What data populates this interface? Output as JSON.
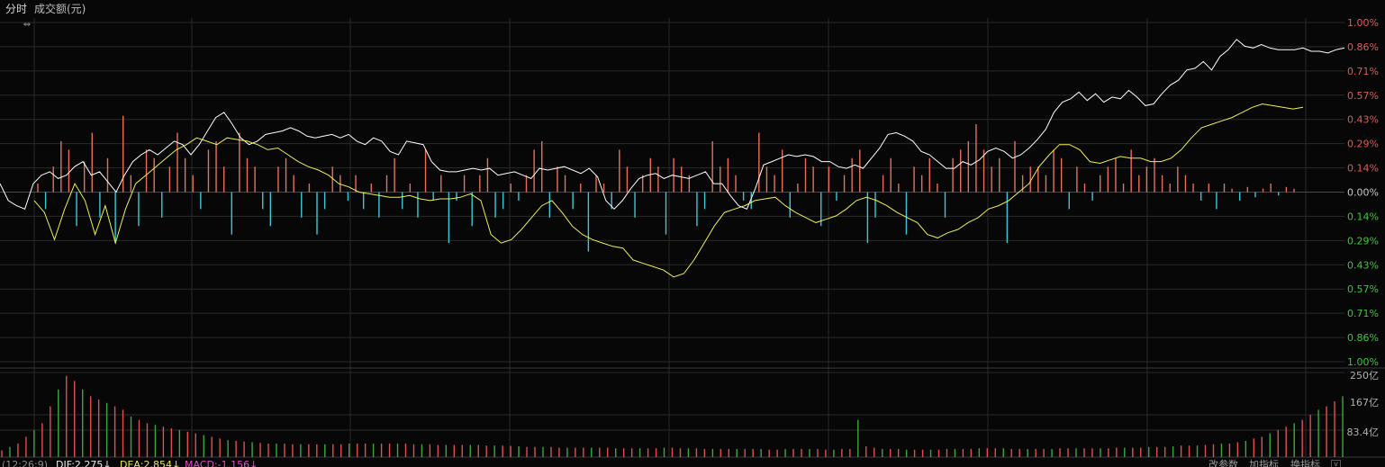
{
  "header": {
    "title": "分时",
    "subtitle": "成交额(元)"
  },
  "footer": {
    "time": "(12:26:9)",
    "dif": "DIF:2.275↓",
    "dea": "DEA:2.854↓",
    "macd": "MACD:-1.156↓",
    "btn_params": "改参数",
    "btn_add": "加指标",
    "btn_switch": "换指标"
  },
  "colors": {
    "background": "#070707",
    "up": "#e8705a",
    "down": "#3cc8d8",
    "price_line": "#ffffff",
    "avg_line": "#f0f050",
    "vol_up": "#e05050",
    "vol_down": "#3ca83c",
    "grid": "#2a2a2a"
  },
  "icons": {
    "drag": "resize-horizontal-icon"
  },
  "chart_data": [
    {
      "type": "line",
      "title": "分时",
      "right_axis_ticks": [
        "1.00%",
        "0.86%",
        "0.71%",
        "0.57%",
        "0.43%",
        "0.29%",
        "0.14%",
        "0.00%",
        "0.14%",
        "0.29%",
        "0.43%",
        "0.57%",
        "0.71%",
        "0.86%",
        "1.00%"
      ],
      "ylim": [
        -1.0,
        1.0
      ],
      "series": [
        {
          "values": [
            0.05,
            -0.05,
            -0.08,
            -0.1,
            0.05,
            0.1,
            0.12,
            0.08,
            0.1,
            0.15,
            0.18,
            0.1,
            0.12,
            0.06,
            0.0,
            0.1,
            0.18,
            0.22,
            0.25,
            0.22,
            0.26,
            0.3,
            0.28,
            0.22,
            0.28,
            0.36,
            0.44,
            0.47,
            0.4,
            0.32,
            0.28,
            0.3,
            0.34,
            0.35,
            0.36,
            0.38,
            0.36,
            0.33,
            0.32,
            0.33,
            0.34,
            0.32,
            0.34,
            0.3,
            0.28,
            0.32,
            0.3,
            0.24,
            0.22,
            0.3,
            0.29,
            0.28,
            0.18,
            0.13,
            0.12,
            0.12,
            0.13,
            0.14,
            0.13,
            0.14,
            0.1,
            0.11,
            0.12,
            0.1,
            0.08,
            0.14,
            0.13,
            0.14,
            0.15,
            0.13,
            0.11,
            0.14,
            0.09,
            -0.05,
            -0.1,
            -0.05,
            0.02,
            0.08,
            0.1,
            0.11,
            0.08,
            0.1,
            0.09,
            0.08,
            0.1,
            0.12,
            0.05,
            0.05,
            -0.02,
            -0.08,
            -0.1,
            0.02,
            0.16,
            0.18,
            0.2,
            0.22,
            0.21,
            0.22,
            0.21,
            0.18,
            0.18,
            0.15,
            0.14,
            0.16,
            0.14,
            0.2,
            0.26,
            0.34,
            0.35,
            0.33,
            0.3,
            0.24,
            0.22,
            0.18,
            0.14,
            0.14,
            0.18,
            0.16,
            0.19,
            0.24,
            0.26,
            0.24,
            0.2,
            0.22,
            0.26,
            0.31,
            0.37,
            0.47,
            0.53,
            0.55,
            0.59,
            0.54,
            0.58,
            0.53,
            0.56,
            0.55,
            0.6,
            0.56,
            0.51,
            0.52,
            0.58,
            0.63,
            0.66,
            0.72,
            0.73,
            0.77,
            0.72,
            0.8,
            0.84,
            0.9,
            0.86,
            0.85,
            0.87,
            0.85,
            0.84,
            0.84,
            0.84,
            0.85,
            0.83,
            0.83,
            0.82,
            0.84,
            0.85
          ]
        },
        {
          "values": [
            -0.05,
            -0.12,
            -0.28,
            -0.1,
            0.05,
            -0.05,
            -0.25,
            -0.08,
            -0.3,
            -0.1,
            0.05,
            0.1,
            0.15,
            0.2,
            0.25,
            0.28,
            0.32,
            0.3,
            0.28,
            0.32,
            0.31,
            0.3,
            0.28,
            0.25,
            0.26,
            0.22,
            0.18,
            0.15,
            0.13,
            0.1,
            0.05,
            0.03,
            0.0,
            -0.01,
            -0.02,
            -0.03,
            -0.03,
            -0.02,
            -0.04,
            -0.05,
            -0.04,
            -0.04,
            -0.03,
            -0.01,
            -0.05,
            -0.25,
            -0.3,
            -0.28,
            -0.22,
            -0.15,
            -0.08,
            -0.05,
            -0.12,
            -0.2,
            -0.25,
            -0.28,
            -0.3,
            -0.32,
            -0.33,
            -0.4,
            -0.42,
            -0.44,
            -0.46,
            -0.5,
            -0.48,
            -0.4,
            -0.3,
            -0.2,
            -0.12,
            -0.1,
            -0.08,
            -0.05,
            -0.04,
            -0.03,
            -0.08,
            -0.12,
            -0.15,
            -0.18,
            -0.16,
            -0.14,
            -0.1,
            -0.05,
            -0.03,
            -0.05,
            -0.08,
            -0.12,
            -0.15,
            -0.18,
            -0.25,
            -0.27,
            -0.24,
            -0.22,
            -0.18,
            -0.15,
            -0.1,
            -0.08,
            -0.05,
            0.0,
            0.05,
            0.15,
            0.22,
            0.28,
            0.28,
            0.25,
            0.18,
            0.17,
            0.19,
            0.21,
            0.2,
            0.2,
            0.18,
            0.18,
            0.2,
            0.25,
            0.32,
            0.38,
            0.4,
            0.42,
            0.44,
            0.47,
            0.5,
            0.52,
            0.51,
            0.5,
            0.49,
            0.5
          ]
        }
      ],
      "bars": [
        0.05,
        -0.1,
        0.15,
        0.3,
        0.25,
        -0.2,
        0.18,
        0.35,
        -0.15,
        0.2,
        -0.3,
        0.45,
        0.1,
        -0.2,
        0.25,
        0.2,
        -0.15,
        0.15,
        0.35,
        0.2,
        0.1,
        -0.1,
        0.25,
        0.3,
        0.15,
        -0.25,
        0.35,
        0.2,
        0.15,
        -0.1,
        -0.2,
        0.15,
        0.2,
        0.1,
        -0.15,
        0.05,
        -0.25,
        -0.1,
        0.15,
        0.1,
        -0.05,
        0.1,
        -0.1,
        0.05,
        -0.15,
        0.1,
        0.2,
        -0.1,
        0.05,
        -0.15,
        0.25,
        -0.05,
        0.1,
        -0.3,
        -0.05,
        0.1,
        -0.2,
        0.1,
        0.2,
        -0.15,
        -0.1,
        0.05,
        -0.05,
        0.1,
        0.25,
        0.3,
        -0.15,
        0.15,
        0.1,
        -0.1,
        0.05,
        -0.35,
        0.1,
        0.05,
        -0.1,
        0.25,
        0.15,
        -0.15,
        0.1,
        0.2,
        0.15,
        -0.25,
        0.2,
        0.15,
        0.1,
        -0.2,
        -0.1,
        0.3,
        0.15,
        0.2,
        0.1,
        -0.05,
        -0.1,
        0.35,
        0.15,
        0.1,
        0.25,
        -0.15,
        0.05,
        0.2,
        0.15,
        -0.2,
        0.15,
        -0.05,
        0.1,
        0.2,
        0.25,
        -0.3,
        -0.15,
        0.1,
        0.2,
        0.05,
        -0.25,
        0.15,
        0.1,
        0.2,
        0.05,
        -0.15,
        0.2,
        0.25,
        0.3,
        0.4,
        0.25,
        0.15,
        0.2,
        -0.3,
        0.3,
        0.1,
        0.15,
        0.15,
        0.1,
        0.25,
        0.2,
        -0.1,
        0.15,
        0.05,
        -0.05,
        0.1,
        0.15,
        0.2,
        0.05,
        0.25,
        0.1,
        0.15,
        0.2,
        0.1,
        0.05,
        0.15,
        0.1,
        0.05,
        -0.05,
        0.05,
        -0.1,
        0.05,
        0.02,
        -0.05,
        0.03,
        -0.03,
        0.02,
        0.05,
        -0.02,
        0.03,
        0.02
      ]
    },
    {
      "type": "bar",
      "title": "成交额(元)",
      "right_axis_ticks": [
        "250亿",
        "167亿",
        "83.4亿"
      ],
      "ylim": [
        0,
        250
      ],
      "values": [
        20,
        30,
        40,
        60,
        80,
        100,
        150,
        200,
        240,
        225,
        200,
        180,
        170,
        160,
        150,
        140,
        120,
        110,
        100,
        95,
        90,
        85,
        80,
        75,
        70,
        65,
        60,
        55,
        50,
        48,
        46,
        44,
        42,
        40,
        40,
        40,
        38,
        38,
        38,
        38,
        38,
        38,
        38,
        40,
        40,
        40,
        40,
        40,
        40,
        40,
        40,
        38,
        38,
        38,
        36,
        36,
        36,
        36,
        36,
        36,
        34,
        34,
        34,
        33,
        32,
        30,
        30,
        30,
        30,
        28,
        28,
        28,
        28,
        28,
        28,
        28,
        26,
        26,
        26,
        26,
        26,
        26,
        28,
        28,
        26,
        26,
        26,
        24,
        24,
        24,
        24,
        24,
        24,
        24,
        24,
        22,
        22,
        24,
        24,
        24,
        24,
        24,
        22,
        22,
        24,
        24,
        110,
        32,
        28,
        24,
        24,
        24,
        22,
        22,
        22,
        22,
        22,
        24,
        24,
        24,
        24,
        26,
        26,
        26,
        26,
        24,
        24,
        24,
        24,
        24,
        24,
        26,
        26,
        26,
        26,
        26,
        26,
        26,
        28,
        28,
        28,
        28,
        30,
        30,
        30,
        32,
        34,
        34,
        34,
        36,
        38,
        40,
        40,
        44,
        48,
        55,
        60,
        70,
        80,
        90,
        100,
        110,
        125,
        140,
        150,
        165,
        180
      ]
    }
  ]
}
